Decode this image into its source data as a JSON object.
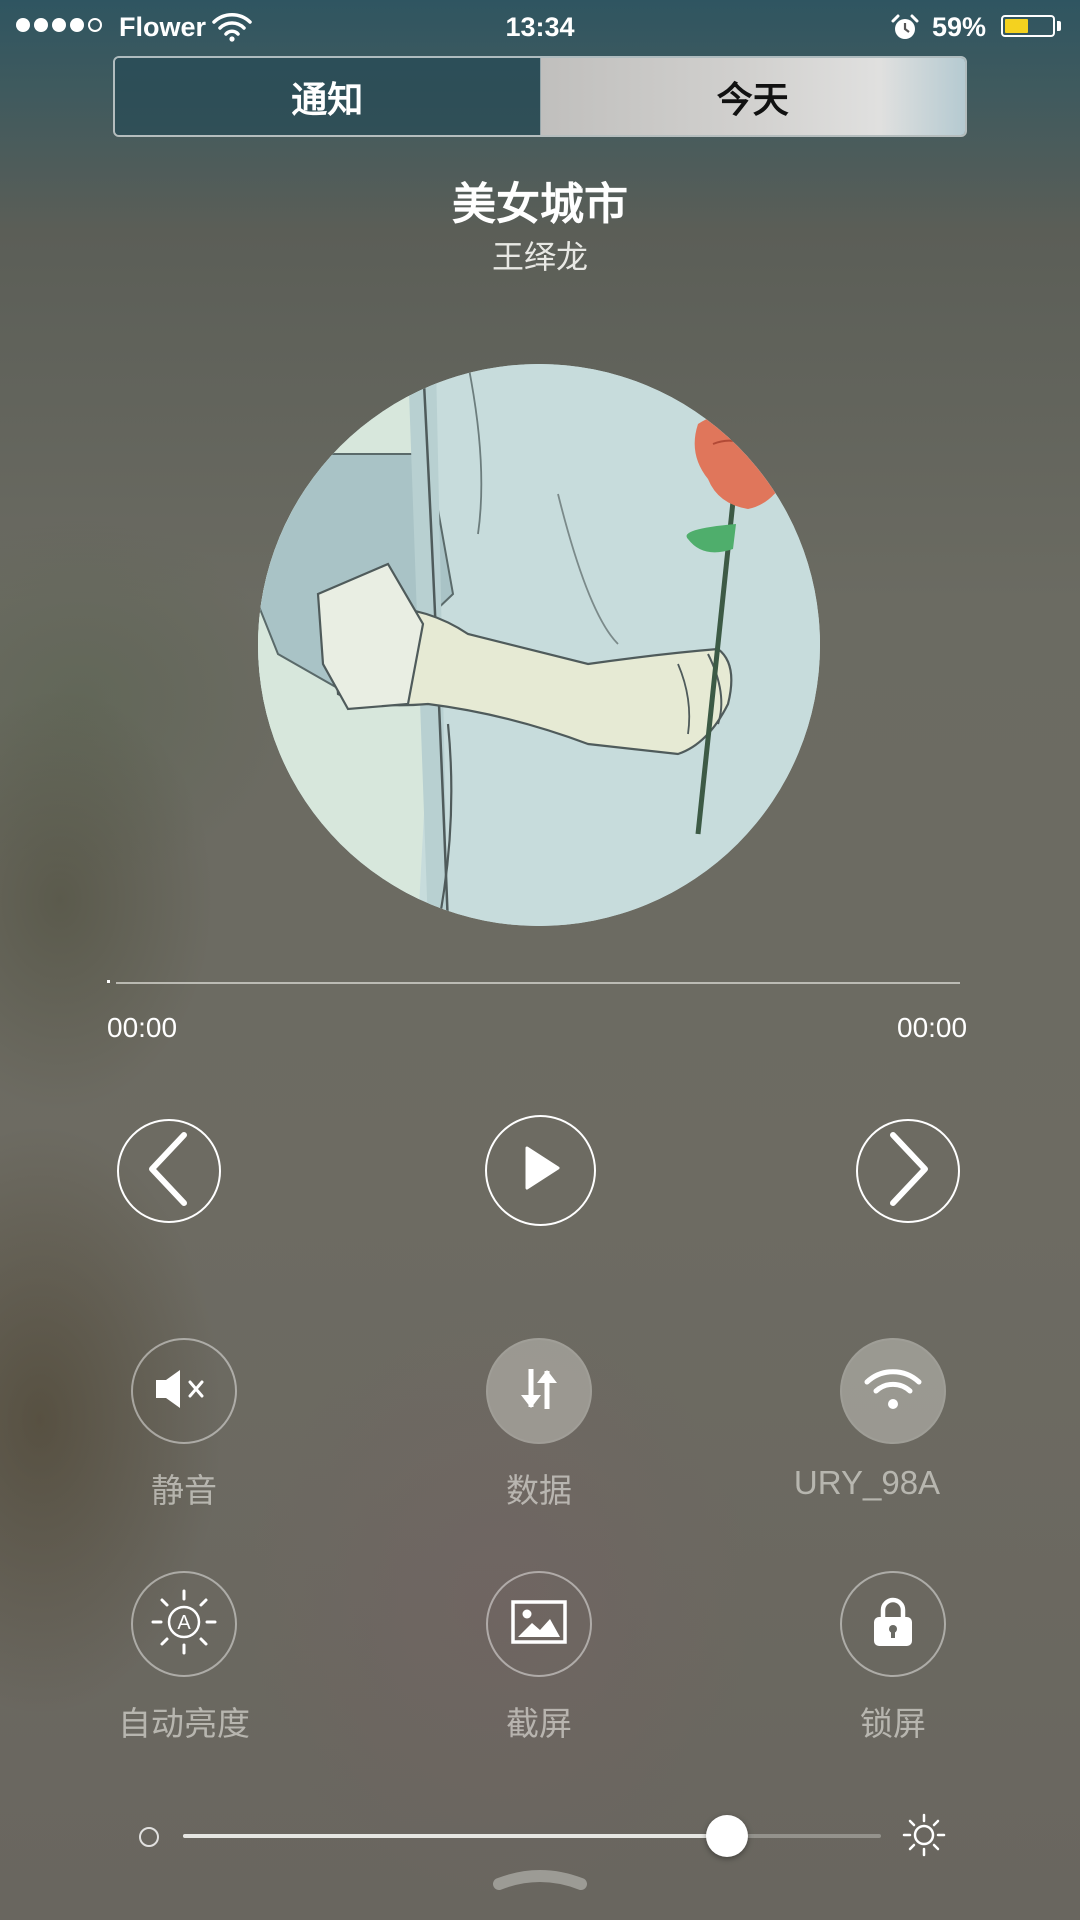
{
  "status_bar": {
    "signal_dots": [
      true,
      true,
      true,
      true,
      false
    ],
    "carrier": "Flower",
    "time": "13:34",
    "battery_percent": "59%",
    "battery_level": 0.5,
    "battery_color": "#f4d21f",
    "icons": [
      "wifi-icon",
      "alarm-clock-icon",
      "battery-icon"
    ]
  },
  "tabs": [
    {
      "label": "通知",
      "selected": false
    },
    {
      "label": "今天",
      "selected": true
    }
  ],
  "music": {
    "title": "美女城市",
    "artist": "王绎龙",
    "album_art": "illustration-hand-holding-rose",
    "current_time": "00:00",
    "total_time": "00:00",
    "progress": 0.0,
    "controls": [
      "previous-icon",
      "play-icon",
      "next-icon"
    ]
  },
  "toggles": [
    {
      "label": "静音",
      "icon": "mute-speaker-icon",
      "active": false
    },
    {
      "label": "数据",
      "icon": "data-transfer-icon",
      "active": true
    },
    {
      "label": "URY_98A",
      "icon": "wifi-icon",
      "active": true
    },
    {
      "label": "自动亮度",
      "icon": "auto-brightness-icon",
      "active": false
    },
    {
      "label": "截屏",
      "icon": "screenshot-icon",
      "active": false
    },
    {
      "label": "锁屏",
      "icon": "lock-icon",
      "active": false
    }
  ],
  "brightness": {
    "level": 0.78
  }
}
